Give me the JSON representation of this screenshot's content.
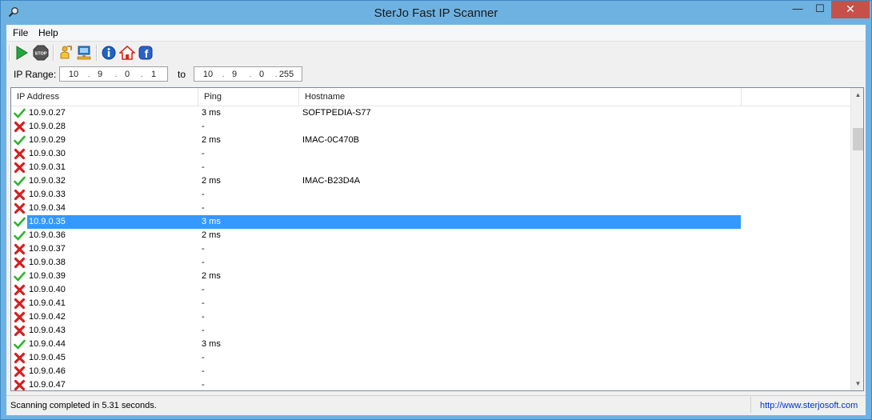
{
  "window": {
    "title": "SterJo Fast IP Scanner",
    "min": "—",
    "max": "☐",
    "close": "✕"
  },
  "menu": {
    "file": "File",
    "help": "Help"
  },
  "range": {
    "label": "IP Range:",
    "to_label": "to",
    "from": [
      "10",
      "9",
      "0",
      "1"
    ],
    "to": [
      "10",
      "9",
      "0",
      "255"
    ]
  },
  "columns": {
    "ip": "IP Address",
    "ping": "Ping",
    "hostname": "Hostname"
  },
  "rows": [
    {
      "ip": "10.9.0.27",
      "ping": "3 ms",
      "hostname": "SOFTPEDIA-S77",
      "alive": true
    },
    {
      "ip": "10.9.0.28",
      "ping": "-",
      "hostname": "",
      "alive": false
    },
    {
      "ip": "10.9.0.29",
      "ping": "2 ms",
      "hostname": "IMAC-0C470B",
      "alive": true
    },
    {
      "ip": "10.9.0.30",
      "ping": "-",
      "hostname": "",
      "alive": false
    },
    {
      "ip": "10.9.0.31",
      "ping": "-",
      "hostname": "",
      "alive": false
    },
    {
      "ip": "10.9.0.32",
      "ping": "2 ms",
      "hostname": "IMAC-B23D4A",
      "alive": true
    },
    {
      "ip": "10.9.0.33",
      "ping": "-",
      "hostname": "",
      "alive": false
    },
    {
      "ip": "10.9.0.34",
      "ping": "-",
      "hostname": "",
      "alive": false
    },
    {
      "ip": "10.9.0.35",
      "ping": "3 ms",
      "hostname": "",
      "alive": true,
      "selected": true
    },
    {
      "ip": "10.9.0.36",
      "ping": "2 ms",
      "hostname": "",
      "alive": true
    },
    {
      "ip": "10.9.0.37",
      "ping": "-",
      "hostname": "",
      "alive": false
    },
    {
      "ip": "10.9.0.38",
      "ping": "-",
      "hostname": "",
      "alive": false
    },
    {
      "ip": "10.9.0.39",
      "ping": "2 ms",
      "hostname": "",
      "alive": true
    },
    {
      "ip": "10.9.0.40",
      "ping": "-",
      "hostname": "",
      "alive": false
    },
    {
      "ip": "10.9.0.41",
      "ping": "-",
      "hostname": "",
      "alive": false
    },
    {
      "ip": "10.9.0.42",
      "ping": "-",
      "hostname": "",
      "alive": false
    },
    {
      "ip": "10.9.0.43",
      "ping": "-",
      "hostname": "",
      "alive": false
    },
    {
      "ip": "10.9.0.44",
      "ping": "3 ms",
      "hostname": "",
      "alive": true
    },
    {
      "ip": "10.9.0.45",
      "ping": "-",
      "hostname": "",
      "alive": false
    },
    {
      "ip": "10.9.0.46",
      "ping": "-",
      "hostname": "",
      "alive": false
    },
    {
      "ip": "10.9.0.47",
      "ping": "-",
      "hostname": "",
      "alive": false
    }
  ],
  "status": {
    "text": "Scanning completed in 5.31 seconds.",
    "link": "http://www.sterjosoft.com"
  },
  "icons": {
    "app": "magnifier-icon",
    "start": "play-icon",
    "stop": "stop-icon",
    "toolbar3": "person-arrow-icon",
    "toolbar4": "computer-icon",
    "info": "info-icon",
    "home": "home-icon",
    "facebook": "facebook-icon",
    "alive": "check-icon",
    "dead": "x-icon"
  },
  "colors": {
    "alive": "#2db52d",
    "dead": "#d42020",
    "selection": "#3399ff",
    "link": "#0033cc"
  }
}
